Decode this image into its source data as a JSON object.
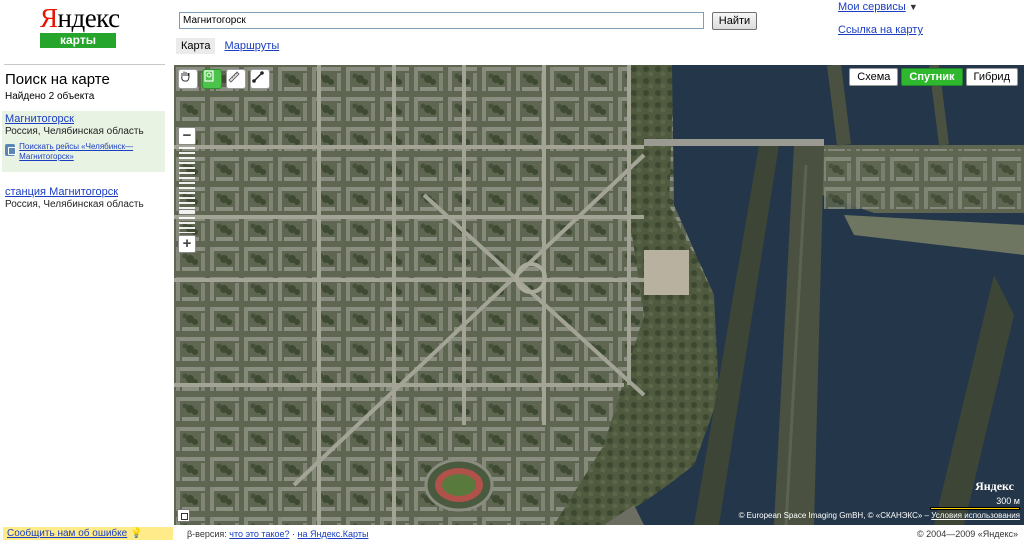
{
  "logo": {
    "brand": "Яндекс",
    "sub": "карты"
  },
  "search": {
    "value": "Магнитогорск",
    "button": "Найти"
  },
  "tabs": [
    {
      "label": "Карта",
      "active": true
    },
    {
      "label": "Маршруты",
      "active": false
    }
  ],
  "header_links": {
    "services": "Мои сервисы",
    "services_arrow": "▼",
    "map_link": "Ссылка на карту"
  },
  "panel": {
    "title": "Поиск на карте",
    "found": "Найдено 2 объекта",
    "results": [
      {
        "title": "Магнитогорск",
        "subtitle": "Россия, Челябинская область",
        "flight_link": "Поискать рейсы «Челябинск—Магнитогорск»"
      },
      {
        "title": "станция Магнитогорск",
        "subtitle": "Россия, Челябинская область"
      }
    ]
  },
  "map": {
    "layers": [
      {
        "label": "Схема",
        "active": false
      },
      {
        "label": "Спутник",
        "active": true
      },
      {
        "label": "Гибрид",
        "active": false
      }
    ],
    "tools": [
      "hand-icon",
      "magnifier-icon",
      "ruler-icon",
      "route-icon"
    ],
    "zoom_in": "+",
    "zoom_out": "−",
    "zoom_level": 0.78,
    "logo": "Яндекс",
    "scale_label": "300 м",
    "copyright": "© European Space Imaging GmBH, © «СКАНЭКС» –",
    "terms_link": "Условия использования"
  },
  "footer": {
    "report": "Сообщить нам об ошибке",
    "beta_prefix": "β-версия:",
    "what_link": "что это такое?",
    "separator": "·",
    "old_link": "на Яндекс.Карты",
    "copyright": "© 2004—2009 «Яндекс»"
  },
  "colors": {
    "brand_red": "#e61400",
    "brand_green": "#25a52b",
    "link": "#1a3dc1",
    "water": "#243649",
    "city": "#5e6651"
  }
}
